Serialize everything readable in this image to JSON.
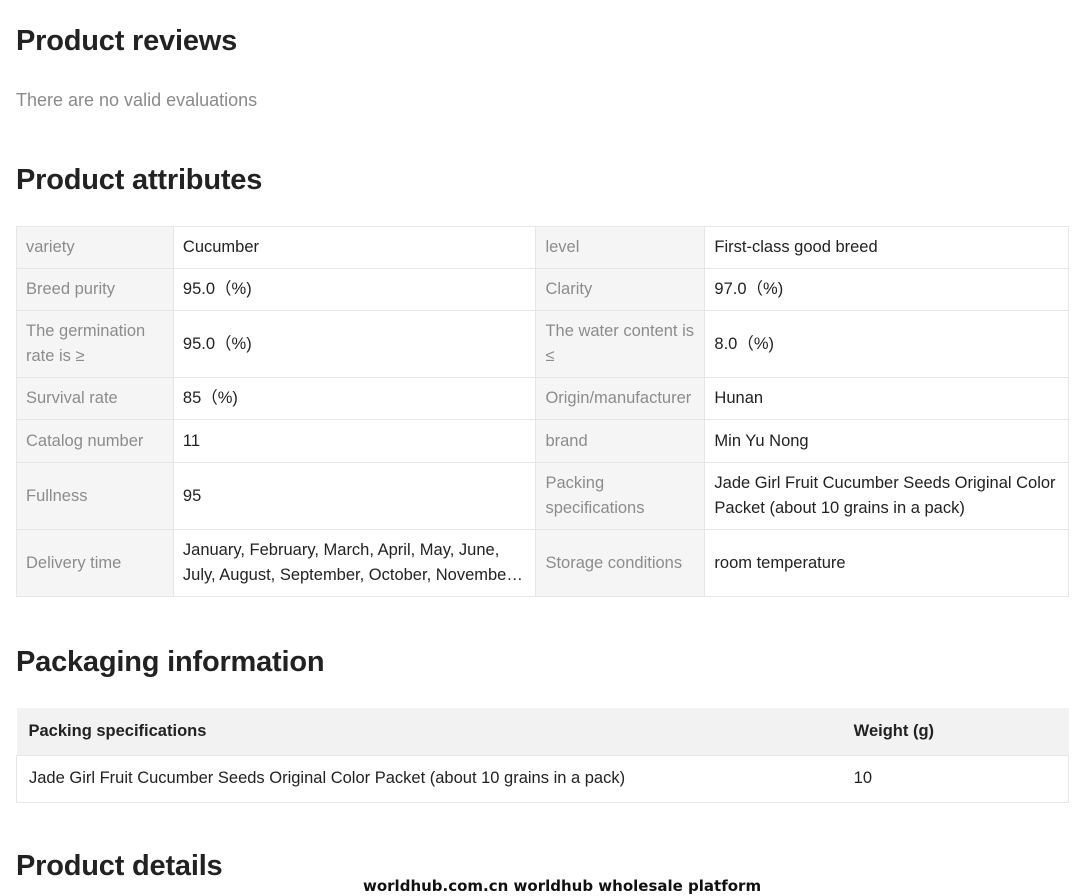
{
  "reviews": {
    "title": "Product reviews",
    "empty_text": "There are no valid evaluations"
  },
  "attributes": {
    "title": "Product attributes",
    "rows": [
      [
        {
          "k": "variety",
          "v": "Cucumber"
        },
        {
          "k": "level",
          "v": "First-class good breed"
        }
      ],
      [
        {
          "k": "Breed purity",
          "v": "95.0（%)"
        },
        {
          "k": "Clarity",
          "v": "97.0（%)"
        }
      ],
      [
        {
          "k": "The germination rate is ≥",
          "v": "95.0（%)"
        },
        {
          "k": "The water content is ≤",
          "v": "8.0（%)"
        }
      ],
      [
        {
          "k": "Survival rate",
          "v": "85（%)"
        },
        {
          "k": "Origin/manufacturer",
          "v": "Hunan"
        }
      ],
      [
        {
          "k": "Catalog number",
          "v": "11"
        },
        {
          "k": "brand",
          "v": "Min Yu Nong"
        }
      ],
      [
        {
          "k": "Fullness",
          "v": "95"
        },
        {
          "k": "Packing specifications",
          "v": "Jade Girl Fruit Cucumber Seeds Original Color Packet (about 10 grains in a pack)"
        }
      ],
      [
        {
          "k": "Delivery time",
          "v": "January, February, March, April, May, June, July, August, September, October, November, December"
        },
        {
          "k": "Storage conditions",
          "v": "room temperature"
        }
      ]
    ]
  },
  "packaging": {
    "title": "Packaging information",
    "headers": [
      "Packing specifications",
      "Weight (g)"
    ],
    "rows": [
      [
        "Jade Girl Fruit Cucumber Seeds Original Color Packet (about 10 grains in a pack)",
        "10"
      ]
    ]
  },
  "details": {
    "title": "Product details"
  },
  "watermark": "worldhub.com.cn worldhub wholesale platform"
}
